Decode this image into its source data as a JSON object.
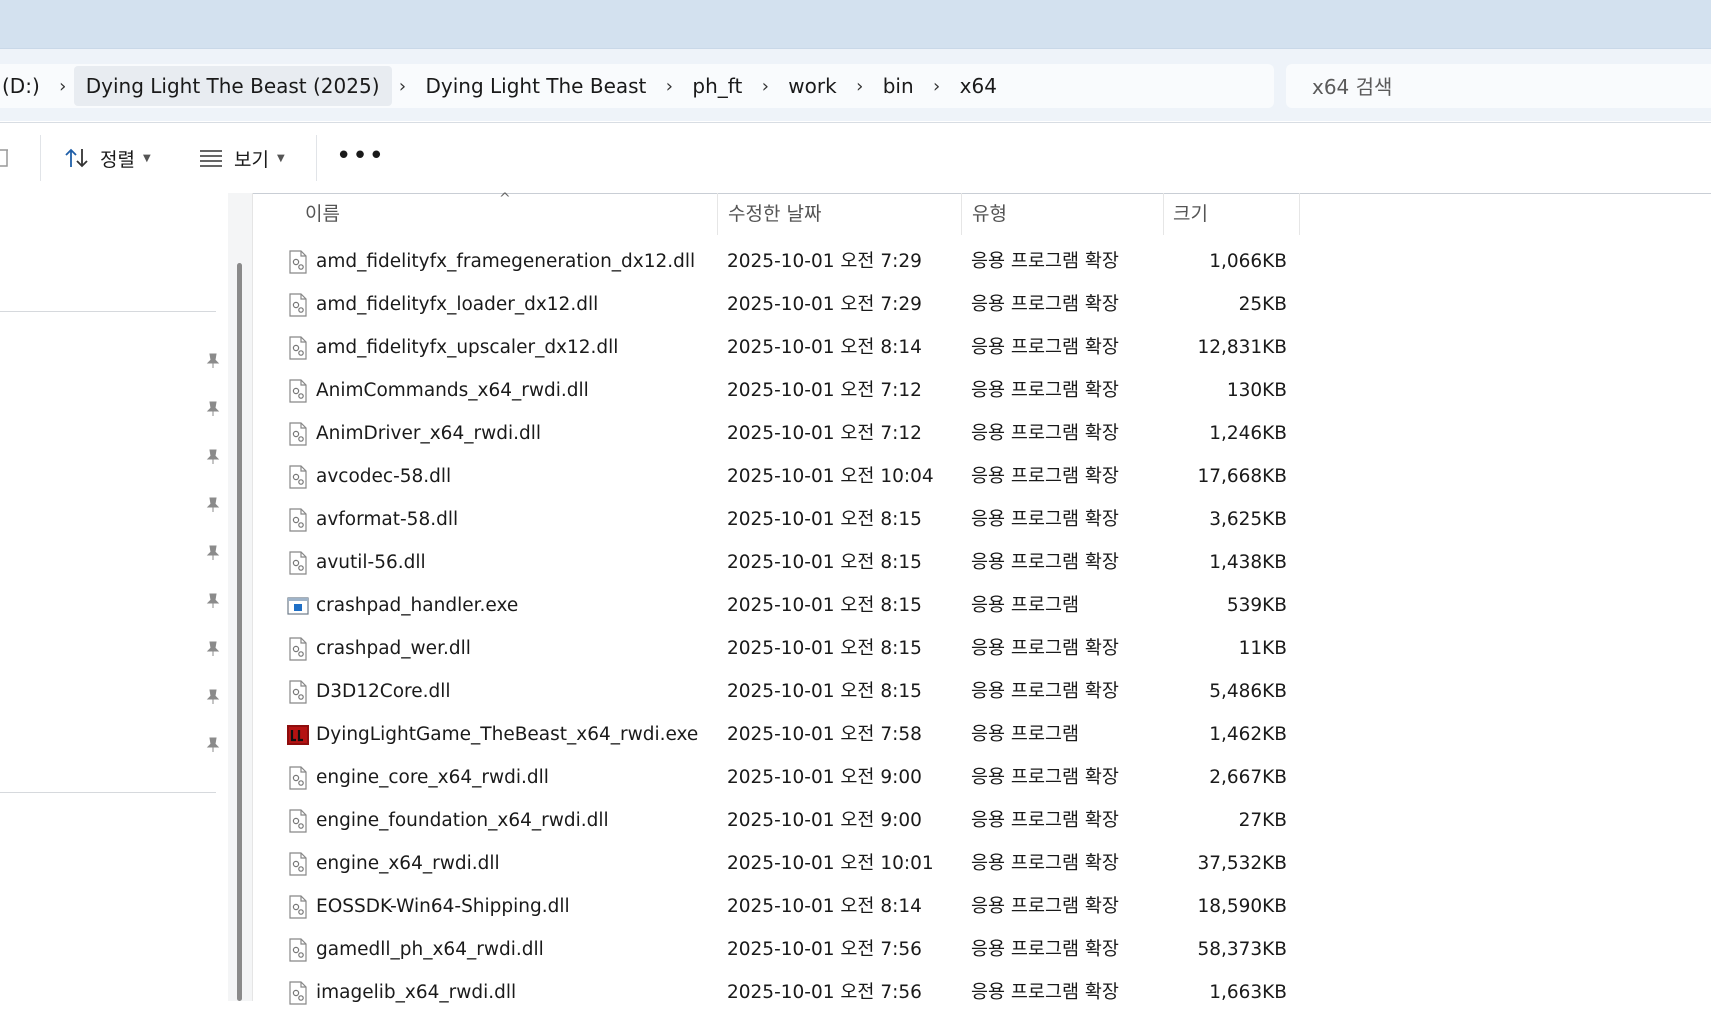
{
  "address": {
    "crumbs": [
      "(D:)",
      "Dying Light The Beast (2025)",
      "Dying Light The Beast",
      "ph_ft",
      "work",
      "bin",
      "x64"
    ]
  },
  "search": {
    "placeholder": "x64 검색"
  },
  "toolbar": {
    "sort_label": "정렬",
    "view_label": "보기",
    "more_label": "•••"
  },
  "columns": {
    "name": "이름",
    "date": "수정한 날짜",
    "type": "유형",
    "size": "크기"
  },
  "files": [
    {
      "name": "amd_fidelityfx_framegeneration_dx12.dll",
      "date": "2025-10-01 오전 7:29",
      "type": "응용 프로그램 확장",
      "size": "1,066KB",
      "icon": "dll"
    },
    {
      "name": "amd_fidelityfx_loader_dx12.dll",
      "date": "2025-10-01 오전 7:29",
      "type": "응용 프로그램 확장",
      "size": "25KB",
      "icon": "dll"
    },
    {
      "name": "amd_fidelityfx_upscaler_dx12.dll",
      "date": "2025-10-01 오전 8:14",
      "type": "응용 프로그램 확장",
      "size": "12,831KB",
      "icon": "dll"
    },
    {
      "name": "AnimCommands_x64_rwdi.dll",
      "date": "2025-10-01 오전 7:12",
      "type": "응용 프로그램 확장",
      "size": "130KB",
      "icon": "dll"
    },
    {
      "name": "AnimDriver_x64_rwdi.dll",
      "date": "2025-10-01 오전 7:12",
      "type": "응용 프로그램 확장",
      "size": "1,246KB",
      "icon": "dll"
    },
    {
      "name": "avcodec-58.dll",
      "date": "2025-10-01 오전 10:04",
      "type": "응용 프로그램 확장",
      "size": "17,668KB",
      "icon": "dll"
    },
    {
      "name": "avformat-58.dll",
      "date": "2025-10-01 오전 8:15",
      "type": "응용 프로그램 확장",
      "size": "3,625KB",
      "icon": "dll"
    },
    {
      "name": "avutil-56.dll",
      "date": "2025-10-01 오전 8:15",
      "type": "응용 프로그램 확장",
      "size": "1,438KB",
      "icon": "dll"
    },
    {
      "name": "crashpad_handler.exe",
      "date": "2025-10-01 오전 8:15",
      "type": "응용 프로그램",
      "size": "539KB",
      "icon": "exe"
    },
    {
      "name": "crashpad_wer.dll",
      "date": "2025-10-01 오전 8:15",
      "type": "응용 프로그램 확장",
      "size": "11KB",
      "icon": "dll"
    },
    {
      "name": "D3D12Core.dll",
      "date": "2025-10-01 오전 8:15",
      "type": "응용 프로그램 확장",
      "size": "5,486KB",
      "icon": "dll"
    },
    {
      "name": "DyingLightGame_TheBeast_x64_rwdi.exe",
      "date": "2025-10-01 오전 7:58",
      "type": "응용 프로그램",
      "size": "1,462KB",
      "icon": "game"
    },
    {
      "name": "engine_core_x64_rwdi.dll",
      "date": "2025-10-01 오전 9:00",
      "type": "응용 프로그램 확장",
      "size": "2,667KB",
      "icon": "dll"
    },
    {
      "name": "engine_foundation_x64_rwdi.dll",
      "date": "2025-10-01 오전 9:00",
      "type": "응용 프로그램 확장",
      "size": "27KB",
      "icon": "dll"
    },
    {
      "name": "engine_x64_rwdi.dll",
      "date": "2025-10-01 오전 10:01",
      "type": "응용 프로그램 확장",
      "size": "37,532KB",
      "icon": "dll"
    },
    {
      "name": "EOSSDK-Win64-Shipping.dll",
      "date": "2025-10-01 오전 8:14",
      "type": "응용 프로그램 확장",
      "size": "18,590KB",
      "icon": "dll"
    },
    {
      "name": "gamedll_ph_x64_rwdi.dll",
      "date": "2025-10-01 오전 7:56",
      "type": "응용 프로그램 확장",
      "size": "58,373KB",
      "icon": "dll"
    },
    {
      "name": "imagelib_x64_rwdi.dll",
      "date": "2025-10-01 오전 7:56",
      "type": "응용 프로그램 확장",
      "size": "1,663KB",
      "icon": "dll"
    }
  ]
}
